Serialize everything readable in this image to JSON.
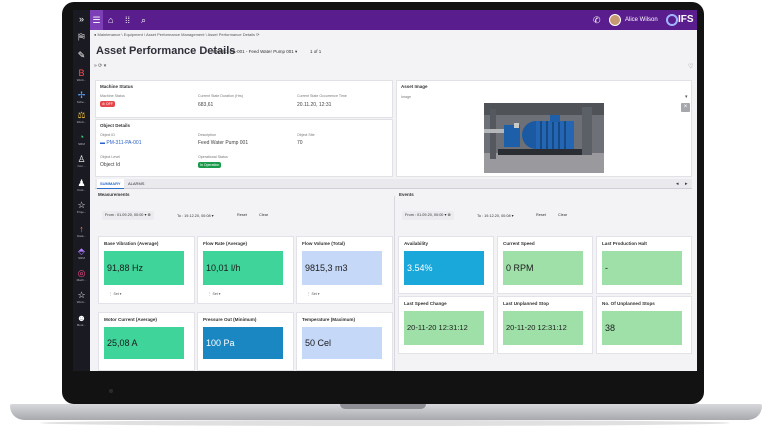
{
  "app": {
    "brand": "IFS",
    "user_name": "Alice Wilson",
    "page_title": "Asset Performance Details",
    "record_selector": "PM-311-PA-001 - Feed Water Pump 001",
    "record_count": "1 of 1",
    "breadcrumb": "Maintenance \\ Equipment \\ Asset Performance Management \\ Asset Performance Details"
  },
  "nav_rail": {
    "items": [
      {
        "icon": "»",
        "label": ""
      },
      {
        "icon": "⛿",
        "label": ""
      },
      {
        "icon": "✎",
        "label": ""
      },
      {
        "icon": "B",
        "label": "Work..."
      },
      {
        "icon": "✢",
        "label": "Sche..."
      },
      {
        "icon": "⚖",
        "label": "Work..."
      },
      {
        "icon": "◔",
        "label": "SRM"
      },
      {
        "icon": "♙",
        "label": "Con..."
      },
      {
        "icon": "♟",
        "label": "Cust..."
      },
      {
        "icon": "☆",
        "label": "Proje..."
      },
      {
        "icon": "↑",
        "label": "Data..."
      },
      {
        "icon": "⬘",
        "label": "SRM"
      },
      {
        "icon": "◎",
        "label": "Mach..."
      },
      {
        "icon": "☆",
        "label": "Work..."
      },
      {
        "icon": "☻",
        "label": "Boot..."
      }
    ]
  },
  "machine_status": {
    "title": "Machine Status",
    "fields": [
      {
        "label": "Machine Status",
        "value": "OFF"
      },
      {
        "label": "Current State Duration (Hrs)",
        "value": "683,61"
      },
      {
        "label": "Current State Occurrence Time",
        "value": "20.11.20, 12:31"
      }
    ]
  },
  "object_details": {
    "title": "Object Details",
    "object_id_label": "Object ID",
    "object_id_value": "PM-311-PA-001",
    "description_label": "Description",
    "description_value": "Feed Water Pump 001",
    "object_site_label": "Object Site",
    "object_site_value": "70",
    "object_level_label": "Object Level",
    "object_level_value": "Object Id",
    "operational_status_label": "Operational Status",
    "operational_status_value": "In Operation"
  },
  "asset_image": {
    "title": "Asset Image",
    "field_label": "Image"
  },
  "tabs": [
    {
      "label": "SUMMARY",
      "active": true
    },
    {
      "label": "ALARMS",
      "active": false
    }
  ],
  "measurements": {
    "title": "Measurements",
    "from_label": "From : 01.09.20, 00:00",
    "to_label": "To : 19.12.20, 00:08",
    "reset_label": "Reset",
    "clear_label": "Clear",
    "set_label": "Set",
    "tiles": [
      {
        "title": "Base Vibration (Average)",
        "value": "91,88 Hz",
        "color": "#3ed49a",
        "has_set": true
      },
      {
        "title": "Flow Rate (Average)",
        "value": "10,01 l/h",
        "color": "#3ed49a",
        "has_set": true
      },
      {
        "title": "Flow Volume (Total)",
        "value": "9815,3 m3",
        "color": "#c5d8f7",
        "has_set": true
      },
      {
        "title": "Motor Current (Average)",
        "value": "25,08 A",
        "color": "#3ed49a",
        "has_set": false
      },
      {
        "title": "Pressure Out (Minimum)",
        "value": "100 Pa",
        "color": "#1a87c2",
        "has_set": false
      },
      {
        "title": "Temperature (Maximum)",
        "value": "50 Cel",
        "color": "#c5d8f7",
        "has_set": false
      }
    ]
  },
  "events": {
    "title": "Events",
    "from_label": "From : 01.09.20, 00:00",
    "to_label": "To : 19.12.20, 00:08",
    "reset_label": "Reset",
    "clear_label": "Clear",
    "tiles": [
      {
        "title": "Availability",
        "value": "3.54%",
        "color": "#1aa7d9"
      },
      {
        "title": "Current Speed",
        "value": "0 RPM",
        "color": "#9fe0a8"
      },
      {
        "title": "Last Production Halt",
        "value": "-",
        "color": "#9fe0a8"
      },
      {
        "title": "Last Speed Change",
        "value": "20-11-20 12:31:12",
        "color": "#9fe0a8"
      },
      {
        "title": "Last Unplanned Stop",
        "value": "20-11-20 12:31:12",
        "color": "#9fe0a8"
      },
      {
        "title": "No. Of Unplanned Stops",
        "value": "38",
        "color": "#9fe0a8"
      }
    ]
  }
}
